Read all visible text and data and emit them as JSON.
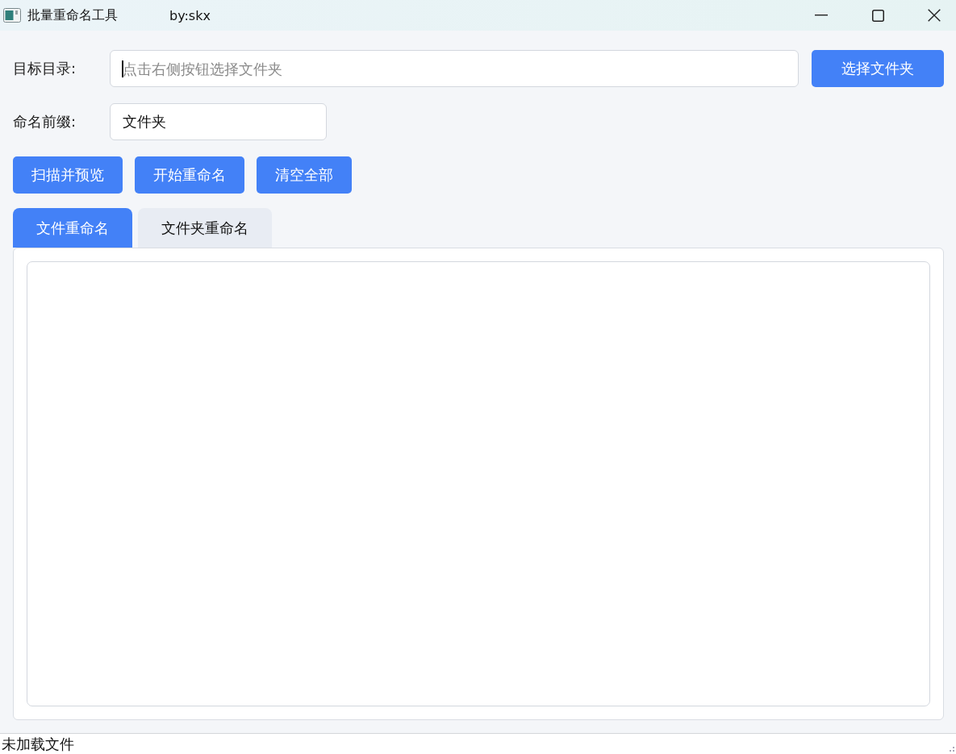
{
  "window": {
    "title": "批量重命名工具",
    "author": "by:skx"
  },
  "form": {
    "target_dir": {
      "label": "目标目录:",
      "placeholder": "点击右侧按钮选择文件夹",
      "focused": true
    },
    "browse_button": "选择文件夹",
    "prefix": {
      "label": "命名前缀:",
      "value": "文件夹"
    }
  },
  "actions": [
    "扫描并预览",
    "开始重命名",
    "清空全部"
  ],
  "tabs": [
    {
      "label": "文件重命名",
      "selected": true
    },
    {
      "label": "文件夹重命名",
      "selected": false
    }
  ],
  "status_bar": {
    "text": "未加载文件"
  }
}
